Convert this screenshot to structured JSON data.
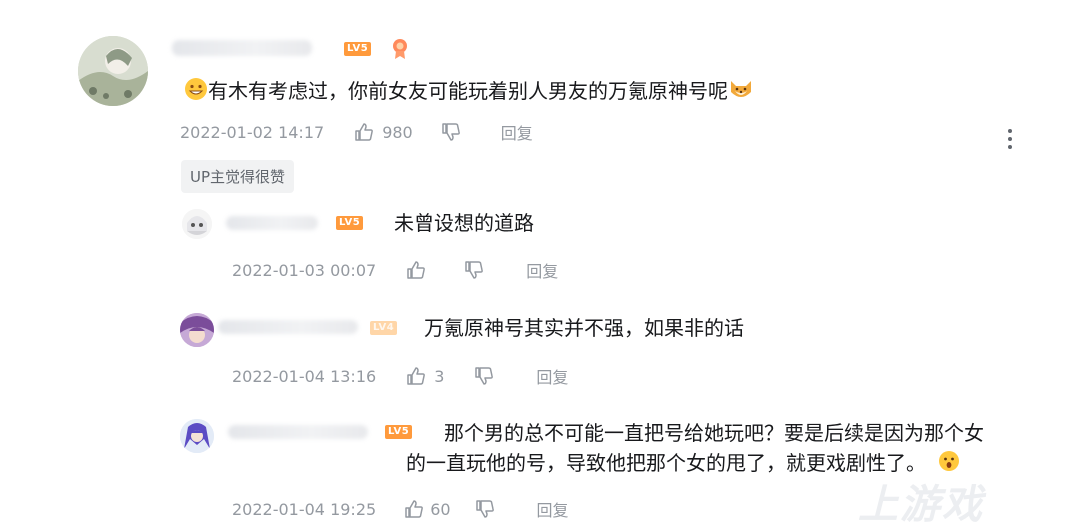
{
  "main_comment": {
    "level": "LV5",
    "text": "有木有考虑过，你前女友可能玩着别人男友的万氪原神号呢",
    "timestamp": "2022-01-02 14:17",
    "likes": "980",
    "reply_label": "回复",
    "up_badge": "UP主觉得很赞"
  },
  "replies": [
    {
      "level": "LV5",
      "text": "未曾设想的道路",
      "timestamp": "2022-01-03 00:07",
      "likes": "",
      "reply_label": "回复"
    },
    {
      "level": "LV4",
      "text": "万氪原神号其实并不强，如果非的话",
      "timestamp": "2022-01-04 13:16",
      "likes": "3",
      "reply_label": "回复"
    },
    {
      "level": "LV5",
      "text_line1": "那个男的总不可能一直把号给她玩吧？要是后续是因为那个女",
      "text_line2": "的一直玩他的号，导致他把那个女的甩了，就更戏剧性了。",
      "timestamp": "2022-01-04 19:25",
      "likes": "60",
      "reply_label": "回复"
    }
  ],
  "icons": {
    "like": "thumbs-up-icon",
    "dislike": "thumbs-down-icon",
    "more": "more-vertical-icon"
  },
  "watermark": "上游戏"
}
